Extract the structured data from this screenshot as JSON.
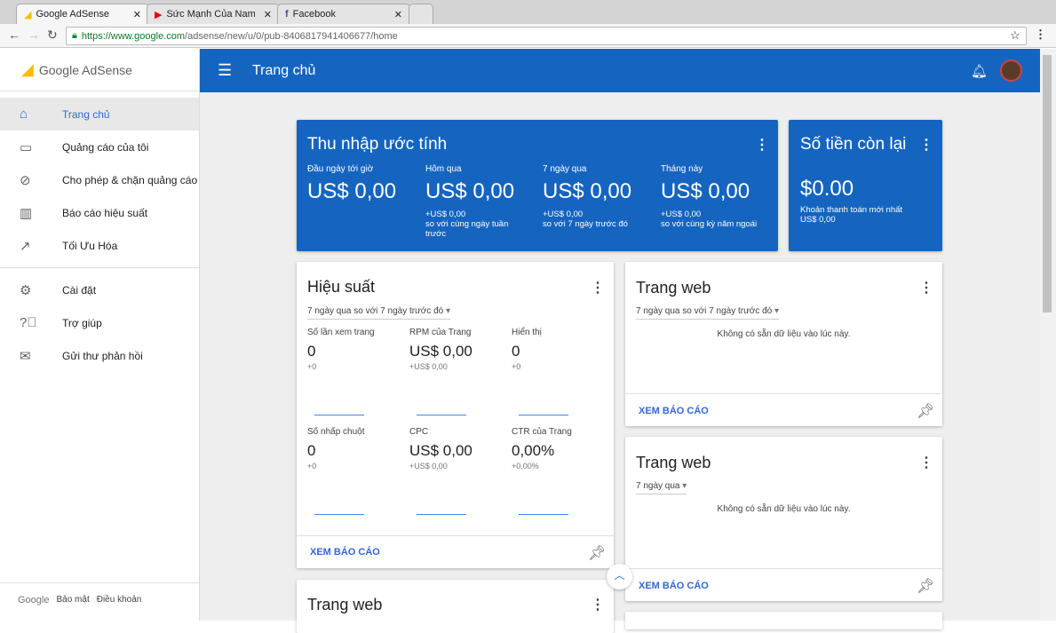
{
  "browser": {
    "tabs": [
      {
        "title": "Google AdSense"
      },
      {
        "title": "Sức Mạnh Của Nam Châ"
      },
      {
        "title": "Facebook"
      }
    ],
    "url_host": "https://www.google.com",
    "url_path": "/adsense/new/u/0/pub-8406817941406677/home"
  },
  "sidebar": {
    "logo": "Google AdSense",
    "items": [
      {
        "label": "Trang chủ",
        "icon": "home-icon"
      },
      {
        "label": "Quảng cáo của tôi",
        "icon": "ad-icon"
      },
      {
        "label": "Cho phép & chặn quảng cáo",
        "icon": "block-icon"
      },
      {
        "label": "Báo cáo hiệu suất",
        "icon": "bar-chart-icon"
      },
      {
        "label": "Tối Ưu Hóa",
        "icon": "trending-icon"
      },
      {
        "label": "Cài đặt",
        "icon": "gear-icon"
      },
      {
        "label": "Trợ giúp",
        "icon": "help-icon"
      },
      {
        "label": "Gửi thư phản hồi",
        "icon": "feedback-icon"
      }
    ],
    "footer": [
      "Google",
      "Bảo mật",
      "Điều khoản"
    ]
  },
  "header": {
    "title": "Trang chủ"
  },
  "earnings": {
    "title": "Thu nhập ước tính",
    "cols": [
      {
        "label": "Đầu ngày tới giờ",
        "value": "US$ 0,00",
        "delta": "",
        "note": ""
      },
      {
        "label": "Hôm qua",
        "value": "US$ 0,00",
        "delta": "+US$ 0,00",
        "note": "so với cùng ngày tuần trước"
      },
      {
        "label": "7 ngày qua",
        "value": "US$ 0,00",
        "delta": "+US$ 0,00",
        "note": "so với 7 ngày trước đó"
      },
      {
        "label": "Tháng này",
        "value": "US$ 0,00",
        "delta": "+US$ 0,00",
        "note": "so với cùng kỳ năm ngoái"
      }
    ]
  },
  "balance": {
    "title": "Số tiền còn lại",
    "value": "$0.00",
    "label": "Khoản thanh toán mới nhất",
    "amount": "US$ 0,00"
  },
  "performance": {
    "title": "Hiệu suất",
    "range": "7 ngày qua so với 7 ngày trước đó",
    "metrics": [
      {
        "label": "Số lần xem trang",
        "value": "0",
        "delta": "+0"
      },
      {
        "label": "RPM của Trang",
        "value": "US$ 0,00",
        "delta": "+US$ 0,00"
      },
      {
        "label": "Hiển thị",
        "value": "0",
        "delta": "+0"
      },
      {
        "label": "Số nhấp chuột",
        "value": "0",
        "delta": "+0"
      },
      {
        "label": "CPC",
        "value": "US$ 0,00",
        "delta": "+US$ 0,00"
      },
      {
        "label": "CTR của Trang",
        "value": "0,00%",
        "delta": "+0,00%"
      }
    ],
    "link": "XEM BÁO CÁO"
  },
  "sites1": {
    "title": "Trang web",
    "range": "7 ngày qua so với 7 ngày trước đó",
    "empty": "Không có sẵn dữ liệu vào lúc này.",
    "link": "XEM BÁO CÁO"
  },
  "sites2": {
    "title": "Trang web",
    "range": "7 ngày qua",
    "empty": "Không có sẵn dữ liệu vào lúc này.",
    "link": "XEM BÁO CÁO"
  },
  "sites3": {
    "title": "Trang web"
  }
}
